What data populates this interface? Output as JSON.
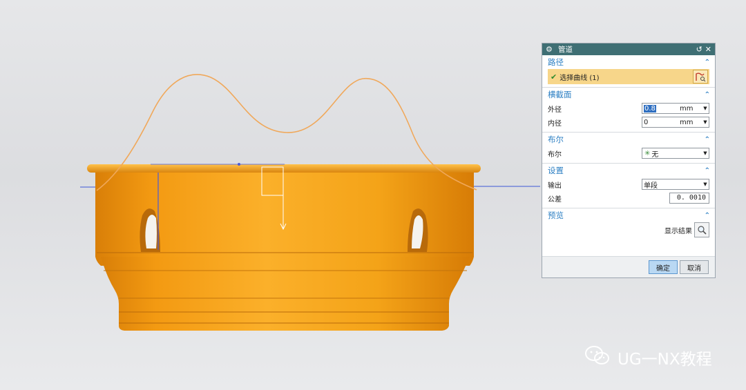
{
  "dialog": {
    "title": "管道",
    "sections": {
      "path": {
        "title": "路径",
        "select_curve_label": "选择曲线 (1)"
      },
      "cross_section": {
        "title": "横截面",
        "outer_label": "外径",
        "outer_value": "0.8",
        "outer_unit": "mm",
        "inner_label": "内径",
        "inner_value": "0",
        "inner_unit": "mm"
      },
      "boolean": {
        "title": "布尔",
        "label": "布尔",
        "value": "无"
      },
      "settings": {
        "title": "设置",
        "output_label": "输出",
        "output_value": "单段",
        "tolerance_label": "公差",
        "tolerance_value": "0. 0010"
      },
      "preview": {
        "title": "预览",
        "show_result_label": "显示结果"
      }
    },
    "ok_label": "确定",
    "cancel_label": "取消"
  },
  "watermark": {
    "text": "UG一NX教程"
  },
  "colors": {
    "part_orange": "#f2a01c",
    "path_curve": "#f0a85a",
    "title_bar": "#3f6f74",
    "accent_blue": "#2c7fc3",
    "selection_highlight": "#f7d68a"
  },
  "icons": {
    "title": "gear-icon",
    "reset": "reset-icon",
    "close": "close-icon",
    "collapse": "chevron-up-icon",
    "check": "check-icon",
    "curve": "curve-select-icon",
    "boolean": "boolean-none-icon",
    "preview": "magnifier-icon",
    "watermark": "wechat-icon"
  }
}
